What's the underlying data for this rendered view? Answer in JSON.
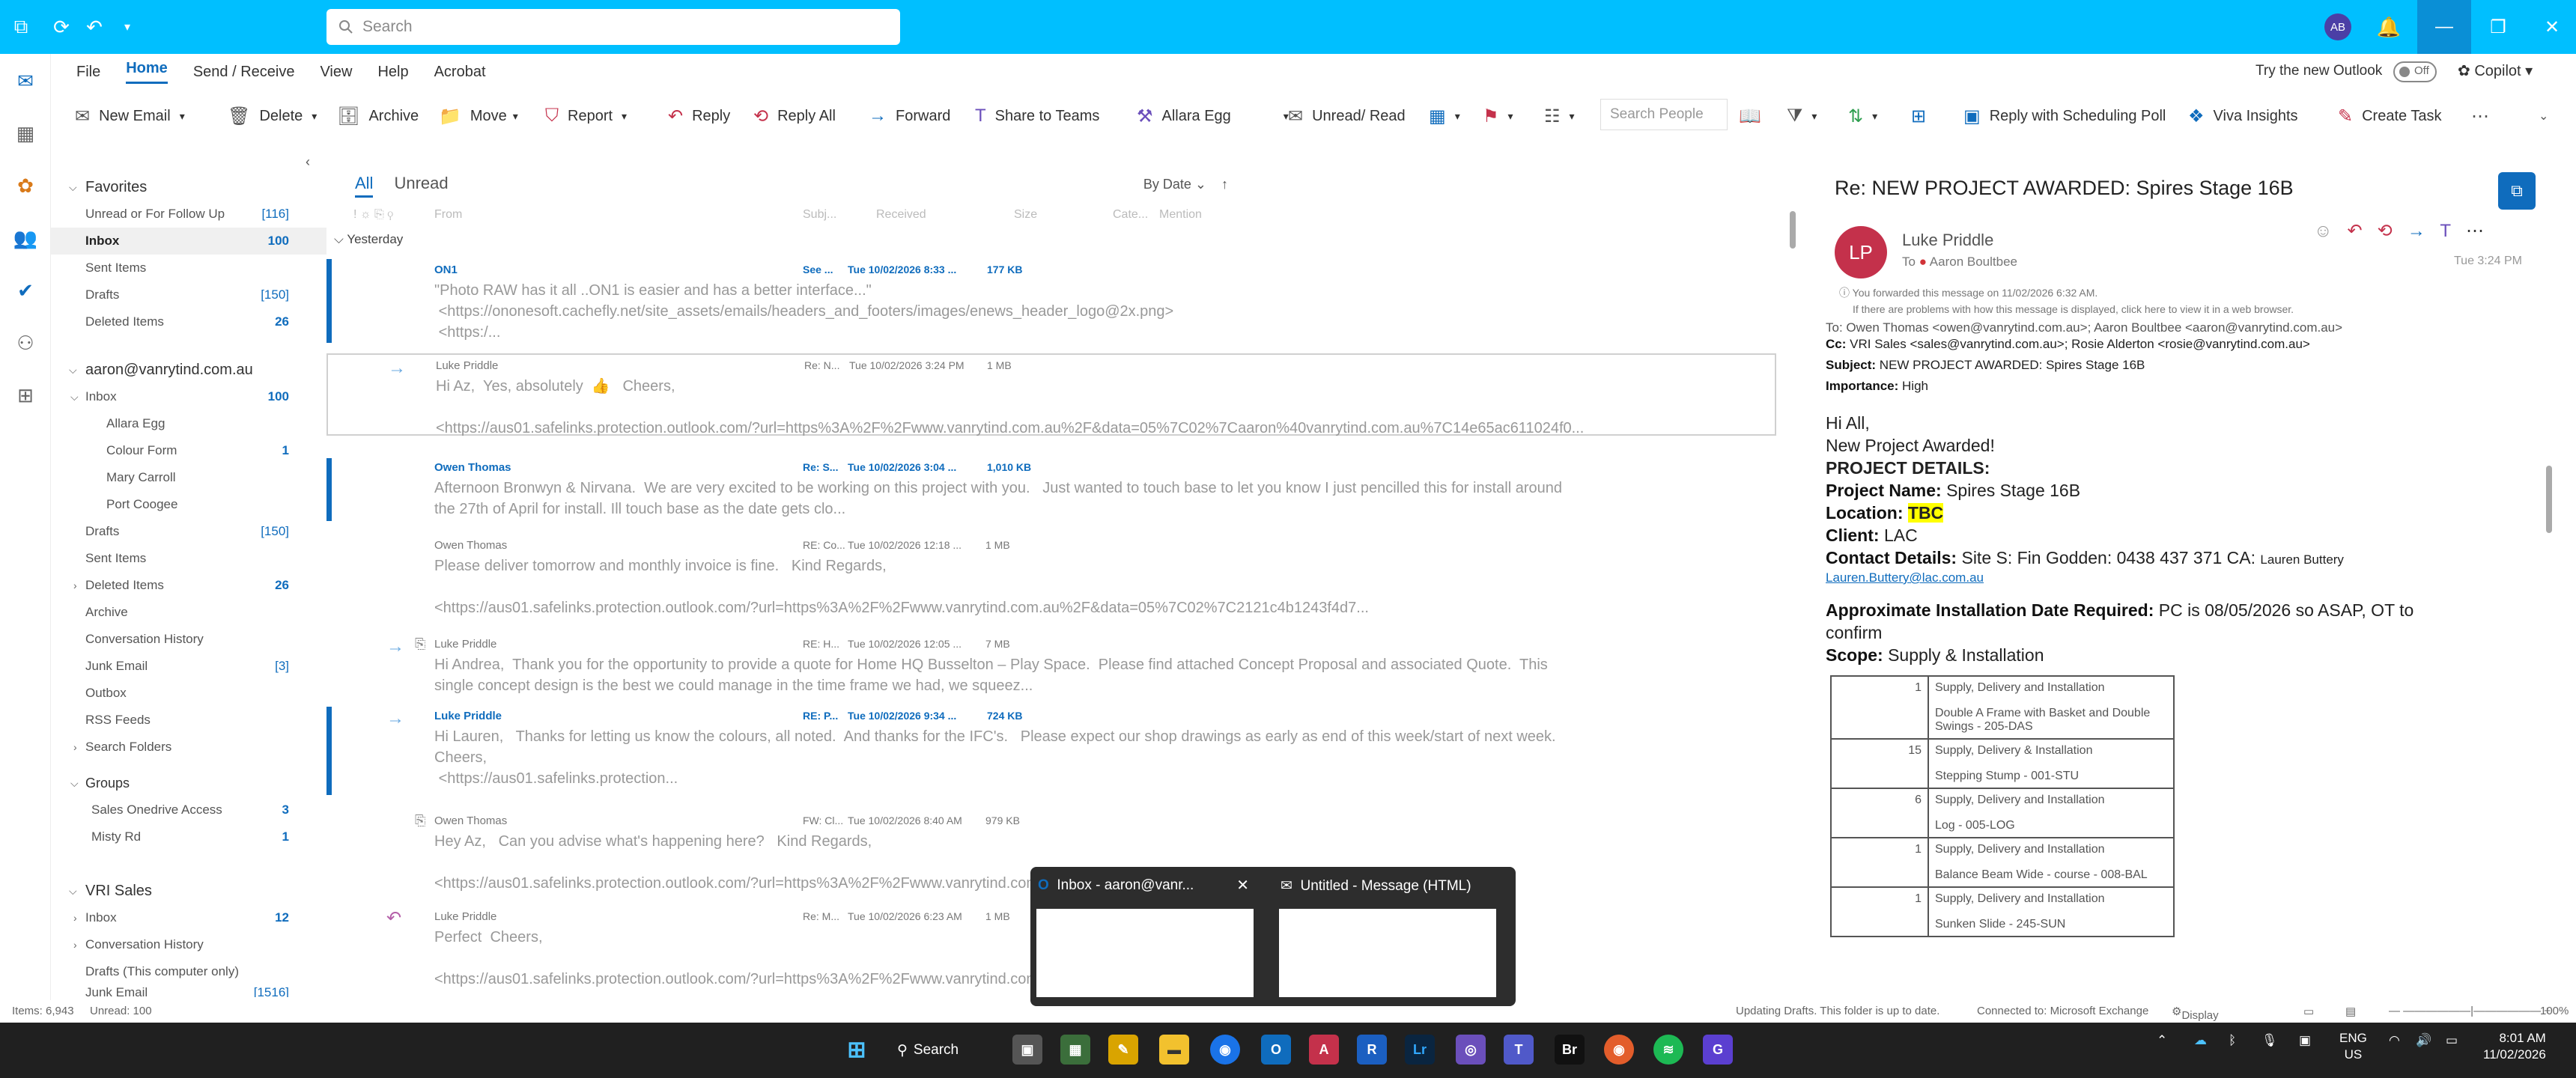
{
  "titlebar": {
    "search_placeholder": "Search",
    "avatar_initials": "AB",
    "accent_color": "#00bfff"
  },
  "menu": [
    "File",
    "Home",
    "Send / Receive",
    "View",
    "Help",
    "Acrobat"
  ],
  "try_outlook": "Try the new Outlook",
  "toggle_state": "Off",
  "copilot": "Copilot",
  "ribbon": {
    "new_email": "New Email",
    "delete": "Delete",
    "archive": "Archive",
    "move": "Move",
    "report": "Report",
    "reply": "Reply",
    "reply_all": "Reply All",
    "forward": "Forward",
    "share_to_teams": "Share to Teams",
    "quick_step": "Allara Egg",
    "unread_read": "Unread/ Read",
    "search_people": "Search People",
    "reply_scheduling": "Reply with Scheduling Poll",
    "viva": "Viva Insights",
    "create_task": "Create Task"
  },
  "folders": {
    "favorites_header": "Favorites",
    "favorites": [
      {
        "label": "Unread or For Follow Up",
        "count": "[116]"
      },
      {
        "label": "Inbox",
        "count": "100"
      },
      {
        "label": "Sent Items",
        "count": ""
      },
      {
        "label": "Drafts",
        "count": "[150]"
      },
      {
        "label": "Deleted Items",
        "count": "26"
      }
    ],
    "account": "aaron@vanrytind.com.au",
    "account_items": [
      {
        "label": "Inbox",
        "count": "100"
      },
      {
        "label": "Allara Egg",
        "count": ""
      },
      {
        "label": "Colour Form",
        "count": "1"
      },
      {
        "label": "Mary Carroll",
        "count": ""
      },
      {
        "label": "Port Coogee",
        "count": ""
      },
      {
        "label": "Drafts",
        "count": "[150]"
      },
      {
        "label": "Sent Items",
        "count": ""
      },
      {
        "label": "Deleted Items",
        "count": "26"
      },
      {
        "label": "Archive",
        "count": ""
      },
      {
        "label": "Conversation History",
        "count": ""
      },
      {
        "label": "Junk Email",
        "count": "[3]"
      },
      {
        "label": "Outbox",
        "count": ""
      },
      {
        "label": "RSS Feeds",
        "count": ""
      },
      {
        "label": "Search Folders",
        "count": ""
      }
    ],
    "groups_header": "Groups",
    "groups": [
      {
        "label": "Sales Onedrive Access",
        "count": "3"
      },
      {
        "label": "Misty Rd",
        "count": "1"
      }
    ],
    "vri_header": "VRI Sales",
    "vri_items": [
      {
        "label": "Inbox",
        "count": "12"
      },
      {
        "label": "Conversation History",
        "count": ""
      },
      {
        "label": "Drafts (This computer only)",
        "count": ""
      },
      {
        "label": "Junk Email",
        "count": "[1516]"
      }
    ]
  },
  "list": {
    "tab_all": "All",
    "tab_unread": "Unread",
    "sort": "By Date",
    "columns": [
      "From",
      "Subj...",
      "Received",
      "Size",
      "Cate...",
      "Mention"
    ],
    "group_yesterday": "Yesterday",
    "messages": [
      {
        "from": "ON1",
        "subject": "See ...",
        "received": "Tue 10/02/2026 8:33 ...",
        "size": "177 KB",
        "unread": true,
        "preview": "\"Photo RAW has it all ..ON1 is easier and has a better interface...\"\n <https://ononesoft.cachefly.net/site_assets/emails/headers_and_footers/images/enews_header_logo@2x.png>\n <https:/..."
      },
      {
        "from": "Luke Priddle",
        "subject": "Re: N...",
        "received": "Tue 10/02/2026 3:24 PM",
        "size": "1 MB",
        "unread": false,
        "preview": "Hi Az,  Yes, absolutely  👍   Cheers,\n\n<https://aus01.safelinks.protection.outlook.com/?url=https%3A%2F%2Fwww.vanrytind.com.au%2F&data=05%7C02%7Caaron%40vanrytind.com.au%7C14e65ac611024f0..."
      },
      {
        "from": "Owen Thomas",
        "subject": "Re: S...",
        "received": "Tue 10/02/2026 3:04 ...",
        "size": "1,010 KB",
        "unread": true,
        "preview": "Afternoon Bronwyn & Nirvana.  We are very excited to be working on this project with you.   Just wanted to touch base to let you know I just pencilled this for install around\nthe 27th of April for install. Ill touch base as the date gets clo..."
      },
      {
        "from": "Owen Thomas",
        "subject": "RE: Co...",
        "received": "Tue 10/02/2026 12:18 ...",
        "size": "1 MB",
        "unread": false,
        "preview": "Please deliver tomorrow and monthly invoice is fine.   Kind Regards,\n\n<https://aus01.safelinks.protection.outlook.com/?url=https%3A%2F%2Fwww.vanrytind.com.au%2F&data=05%7C02%7C2121c4b1243f4d7..."
      },
      {
        "from": "Luke Priddle",
        "subject": "RE: H...",
        "received": "Tue 10/02/2026 12:05 ...",
        "size": "7 MB",
        "unread": false,
        "preview": "Hi Andrea,  Thank you for the opportunity to provide a quote for Home HQ Busselton – Play Space.  Please find attached Concept Proposal and associated Quote.  This\nsingle concept design is the best we could manage in the time frame we had, we squeez..."
      },
      {
        "from": "Luke Priddle",
        "subject": "RE: P...",
        "received": "Tue 10/02/2026 9:34 ...",
        "size": "724 KB",
        "unread": true,
        "preview": "Hi Lauren,   Thanks for letting us know the colours, all noted.  And thanks for the IFC's.   Please expect our shop drawings as early as end of this week/start of next week.\nCheers,\n <https://aus01.safelinks.protection..."
      },
      {
        "from": "Owen Thomas",
        "subject": "FW: Cl...",
        "received": "Tue 10/02/2026 8:40 AM",
        "size": "979 KB",
        "unread": false,
        "preview": "Hey Az,   Can you advise what's happening here?   Kind Regards,\n\n<https://aus01.safelinks.protection.outlook.com/?url=https%3A%2F%2Fwww.vanrytind.com.au%2F&data=05%7C02%7Cb911a96a9ab34cf..."
      },
      {
        "from": "Luke Priddle",
        "subject": "Re: M...",
        "received": "Tue 10/02/2026 6:23 AM",
        "size": "1 MB",
        "unread": false,
        "preview": "Perfect  Cheers,\n\n<https://aus01.safelinks.protection.outlook.com/?url=https%3A%2F%2Fwww.vanrytind.com.au%2F&data=05%7C02%7Cb38a5236afb40a..."
      }
    ]
  },
  "reading": {
    "title": "Re: NEW PROJECT AWARDED: Spires Stage 16B",
    "avatar": "LP",
    "from": "Luke Priddle",
    "to_label": "To",
    "to": "Aaron Boultbee",
    "time": "Tue 3:24 PM",
    "info1": "You forwarded this message on 11/02/2026 6:32 AM.",
    "info2": "If there are problems with how this message is displayed, click here to view it in a web browser.",
    "to_line": "To: Owen Thomas <owen@vanrytind.com.au>; Aaron Boultbee <aaron@vanrytind.com.au>",
    "cc_label": "Cc:",
    "cc_line": "VRI Sales <sales@vanrytind.com.au>; Rosie Alderton <rosie@vanrytind.com.au>",
    "subject_label": "Subject:",
    "subject": "NEW PROJECT AWARDED: Spires Stage 16B",
    "importance_label": "Importance:",
    "importance": "High",
    "greeting": "Hi All,",
    "headline": "New Project Awarded!",
    "details_label": "PROJECT DETAILS:",
    "project_label": "Project Name:",
    "project": "Spires Stage 16B",
    "location_label": "Location:",
    "location": "TBC",
    "client_label": "Client:",
    "client": "LAC",
    "contact_label": "Contact Details:",
    "contact": "Site S: Fin Godden: 0438 437 371   CA:",
    "contact_ca": "Lauren Buttery",
    "contact_email": "Lauren.Buttery@lac.com.au",
    "install_label": "Approximate Installation Date Required:",
    "install1": "PC is 08/05/2026 so ASAP, OT to",
    "install2": "confirm",
    "scope_label": "Scope:",
    "scope": "Supply & Installation",
    "table": [
      {
        "qty": "1",
        "lines": [
          "Supply, Delivery and Installation",
          "Double A Frame with Basket and Double Swings - 205-DAS"
        ]
      },
      {
        "qty": "15",
        "lines": [
          "Supply, Delivery & Installation",
          "Stepping Stump - 001-STU"
        ]
      },
      {
        "qty": "6",
        "lines": [
          "Supply, Delivery and Installation",
          "Log - 005-LOG"
        ]
      },
      {
        "qty": "1",
        "lines": [
          "Supply, Delivery and Installation",
          "Balance Beam Wide - course - 008-BAL"
        ]
      },
      {
        "qty": "1",
        "lines": [
          "Supply, Delivery and Installation",
          "Sunken Slide - 245-SUN"
        ]
      }
    ]
  },
  "status": {
    "items": "Items: 6,943",
    "unread": "Unread: 100",
    "updating": "Updating Drafts.  This folder is up to date.",
    "connected": "Connected to: Microsoft Exchange",
    "display": "Display Settings",
    "zoom": "100%"
  },
  "preview": {
    "p1": "Inbox - aaron@vanr...",
    "p2": "Untitled - Message (HTML)"
  },
  "taskbar": {
    "search": "Search",
    "lang1": "ENG",
    "lang2": "US",
    "time": "8:01 AM",
    "date": "11/02/2026"
  }
}
